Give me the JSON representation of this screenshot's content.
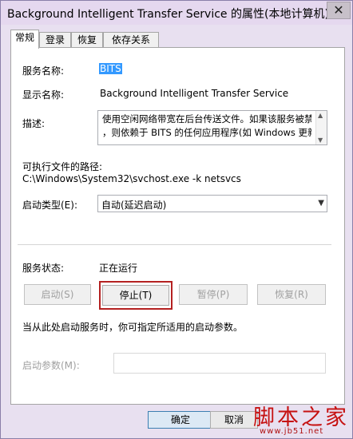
{
  "window": {
    "title": "Background Intelligent Transfer Service 的属性(本地计算机)",
    "close_label": "✕"
  },
  "tabs": [
    {
      "label": "常规"
    },
    {
      "label": "登录"
    },
    {
      "label": "恢复"
    },
    {
      "label": "依存关系"
    }
  ],
  "general": {
    "service_name_label": "服务名称:",
    "service_name_value": "BITS",
    "display_name_label": "显示名称:",
    "display_name_value": "Background Intelligent Transfer Service",
    "description_label": "描述:",
    "description_lines": [
      "使用空闲网络带宽在后台传送文件。如果该服务被禁用",
      "，则依赖于 BITS 的任何应用程序(如 Windows 更新"
    ],
    "exe_path_label": "可执行文件的路径:",
    "exe_path_value": "C:\\Windows\\System32\\svchost.exe -k netsvcs",
    "startup_type_label": "启动类型(E):",
    "startup_type_value": "自动(延迟启动)",
    "status_label": "服务状态:",
    "status_value": "正在运行",
    "buttons": {
      "start": "启动(S)",
      "stop": "停止(T)",
      "pause": "暂停(P)",
      "resume": "恢复(R)"
    },
    "hint_text": "当从此处启动服务时，你可指定所适用的启动参数。",
    "start_params_label": "启动参数(M):",
    "start_params_value": ""
  },
  "footer": {
    "ok": "确定",
    "cancel": "取消"
  },
  "watermark": {
    "main": "脚本之家",
    "sub": "www.jb51.net"
  },
  "colors": {
    "selection": "#3399ff",
    "highlight": "#b42121",
    "watermark": "#c61111"
  }
}
